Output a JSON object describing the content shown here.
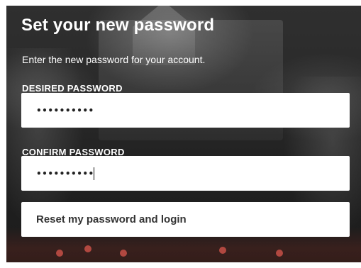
{
  "form": {
    "title": "Set your new password",
    "subtitle": "Enter the new password for your account.",
    "desired_label": "DESIRED PASSWORD",
    "desired_value": "••••••••••",
    "confirm_label": "CONFIRM PASSWORD",
    "confirm_value": "••••••••••",
    "submit_label": "Reset my password and login"
  },
  "colors": {
    "text": "#ffffff",
    "input_bg": "#ffffff",
    "button_text": "#333333"
  }
}
